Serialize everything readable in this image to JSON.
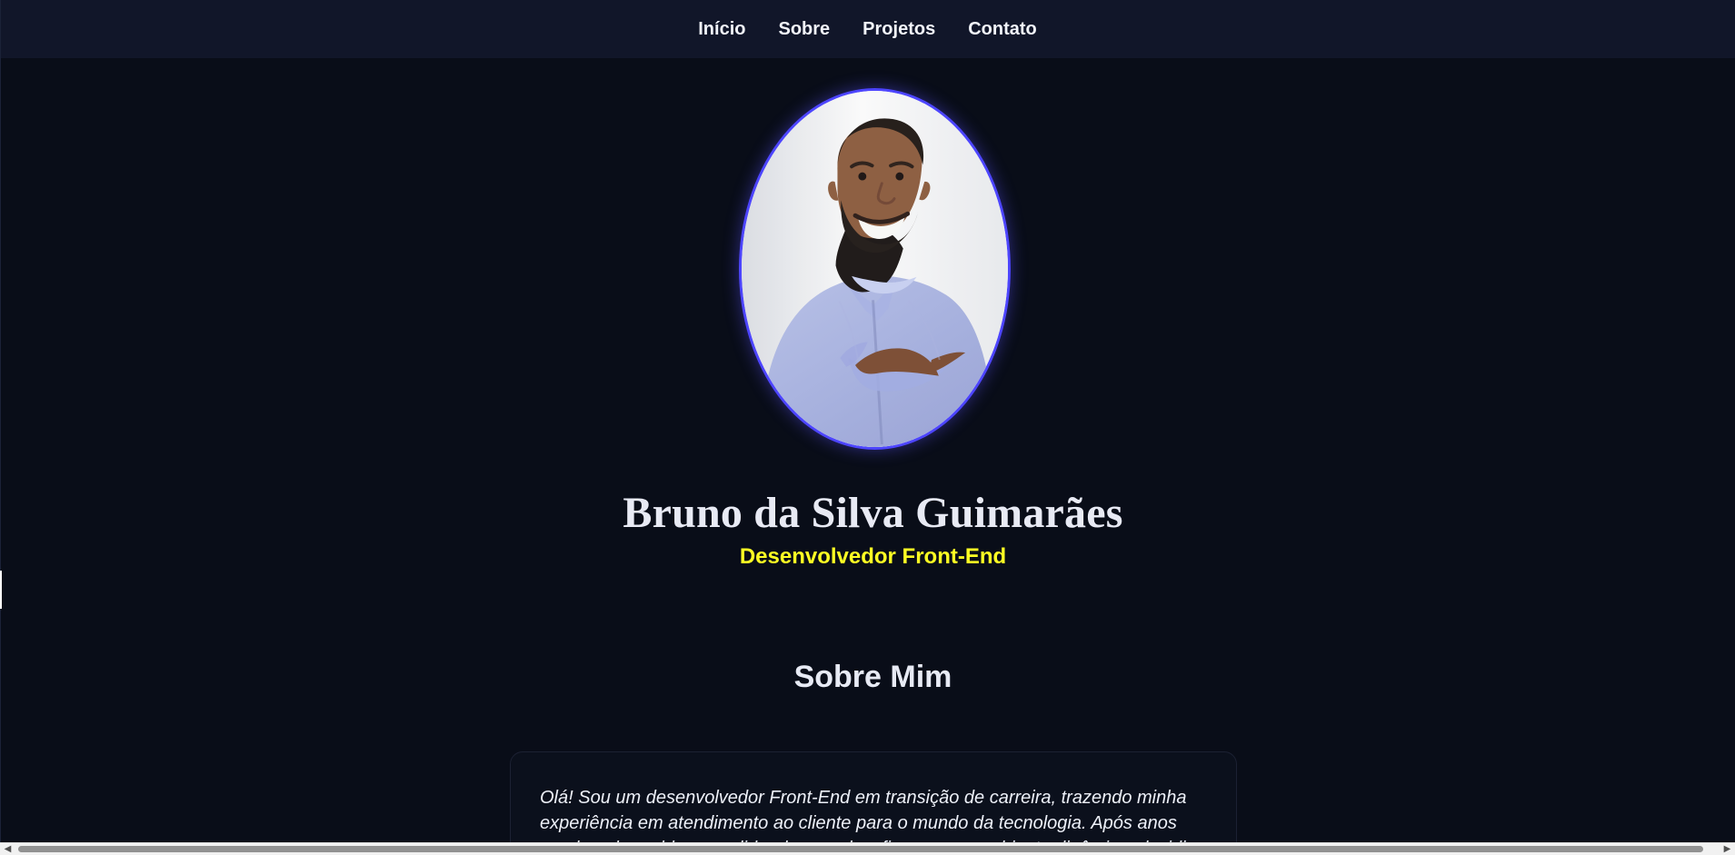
{
  "nav": {
    "items": [
      {
        "label": "Início"
      },
      {
        "label": "Sobre"
      },
      {
        "label": "Projetos"
      },
      {
        "label": "Contato"
      }
    ]
  },
  "hero": {
    "name": "Bruno da Silva Guimarães",
    "subtitle": "Desenvolvedor Front-End"
  },
  "about": {
    "title": "Sobre Mim",
    "text": "Olá! Sou um desenvolvedor Front-End em transição de carreira, trazendo minha experiência em atendimento ao cliente para o mundo da tecnologia. Após anos resolvendo problemas e lidando com desafios em um ambiente dinâmico, decidi"
  },
  "scrollbar": {
    "left_icon": "chevron-left-icon",
    "right_icon": "chevron-right-icon"
  },
  "colors": {
    "background": "#090d18",
    "nav_background": "#111629",
    "accent_yellow": "#ffff23",
    "portrait_border": "#4d45ff"
  }
}
